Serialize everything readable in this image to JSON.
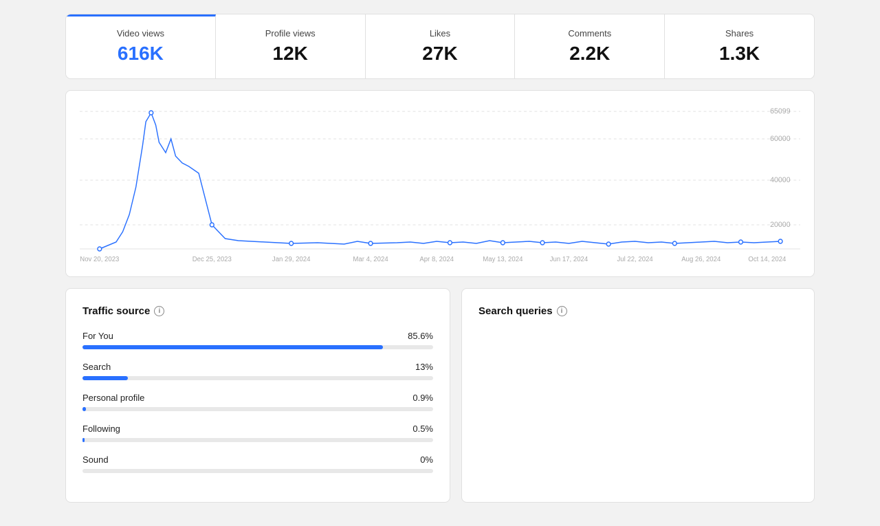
{
  "stats": {
    "items": [
      {
        "label": "Video views",
        "value": "616K",
        "active": true,
        "blue": true
      },
      {
        "label": "Profile views",
        "value": "12K",
        "active": false,
        "blue": false
      },
      {
        "label": "Likes",
        "value": "27K",
        "active": false,
        "blue": false
      },
      {
        "label": "Comments",
        "value": "2.2K",
        "active": false,
        "blue": false
      },
      {
        "label": "Shares",
        "value": "1.3K",
        "active": false,
        "blue": false
      }
    ]
  },
  "chart": {
    "yLabels": [
      "65099",
      "60000",
      "40000",
      "20000"
    ],
    "xLabels": [
      "Nov 20, 2023",
      "Dec 25, 2023",
      "Jan 29, 2024",
      "Mar 4, 2024",
      "Apr 8, 2024",
      "May 13, 2024",
      "Jun 17, 2024",
      "Jul 22, 2024",
      "Aug 26, 2024",
      "Oct 14, 2024"
    ]
  },
  "traffic": {
    "title": "Traffic source",
    "items": [
      {
        "label": "For You",
        "pct": "85.6%",
        "fill": 85.6
      },
      {
        "label": "Search",
        "pct": "13%",
        "fill": 13
      },
      {
        "label": "Personal profile",
        "pct": "0.9%",
        "fill": 0.9
      },
      {
        "label": "Following",
        "pct": "0.5%",
        "fill": 0.5
      },
      {
        "label": "Sound",
        "pct": "0%",
        "fill": 0
      }
    ]
  },
  "search": {
    "title": "Search queries"
  },
  "icons": {
    "info": "i"
  }
}
